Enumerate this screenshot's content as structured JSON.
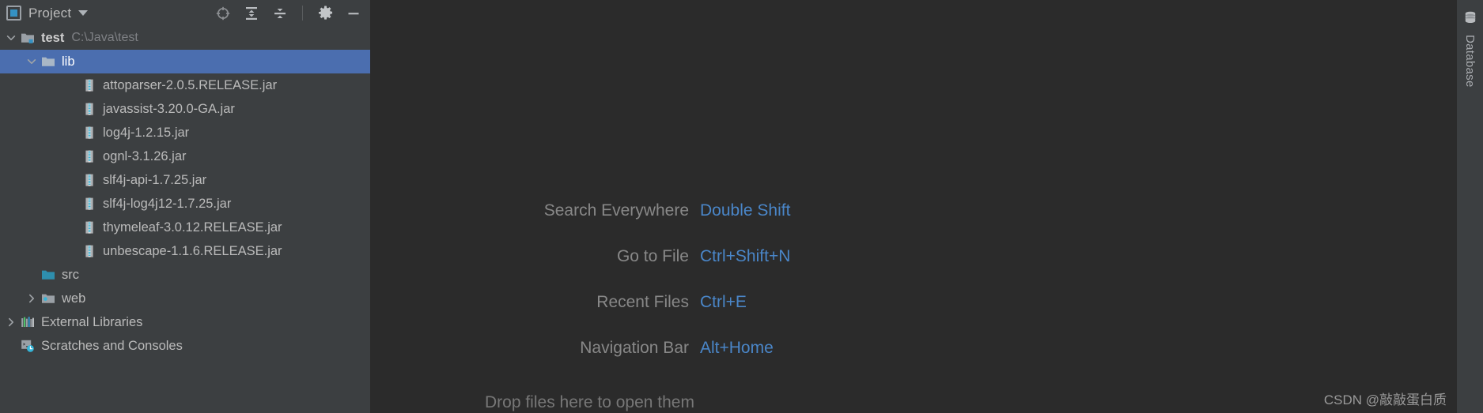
{
  "panel": {
    "title": "Project",
    "icons": {
      "window": "project-window-icon",
      "dropdown": "chevron-down-icon",
      "locate": "scroll-from-source-icon",
      "expand": "expand-all-icon",
      "collapse": "collapse-all-icon",
      "settings": "gear-icon",
      "hide": "minimize-icon"
    }
  },
  "tree": {
    "rows": [
      {
        "label": "test",
        "sub": "C:\\Java\\test",
        "indent": 0,
        "arrow": "expanded",
        "icon": "module-folder-icon",
        "bold": true,
        "selected": false
      },
      {
        "label": "lib",
        "sub": "",
        "indent": 1,
        "arrow": "expanded",
        "icon": "folder-icon",
        "bold": false,
        "selected": true
      },
      {
        "label": "attoparser-2.0.5.RELEASE.jar",
        "sub": "",
        "indent": 3,
        "arrow": "none",
        "icon": "jar-icon",
        "bold": false,
        "selected": false
      },
      {
        "label": "javassist-3.20.0-GA.jar",
        "sub": "",
        "indent": 3,
        "arrow": "none",
        "icon": "jar-icon",
        "bold": false,
        "selected": false
      },
      {
        "label": "log4j-1.2.15.jar",
        "sub": "",
        "indent": 3,
        "arrow": "none",
        "icon": "jar-icon",
        "bold": false,
        "selected": false
      },
      {
        "label": "ognl-3.1.26.jar",
        "sub": "",
        "indent": 3,
        "arrow": "none",
        "icon": "jar-icon",
        "bold": false,
        "selected": false
      },
      {
        "label": "slf4j-api-1.7.25.jar",
        "sub": "",
        "indent": 3,
        "arrow": "none",
        "icon": "jar-icon",
        "bold": false,
        "selected": false
      },
      {
        "label": "slf4j-log4j12-1.7.25.jar",
        "sub": "",
        "indent": 3,
        "arrow": "none",
        "icon": "jar-icon",
        "bold": false,
        "selected": false
      },
      {
        "label": "thymeleaf-3.0.12.RELEASE.jar",
        "sub": "",
        "indent": 3,
        "arrow": "none",
        "icon": "jar-icon",
        "bold": false,
        "selected": false
      },
      {
        "label": "unbescape-1.1.6.RELEASE.jar",
        "sub": "",
        "indent": 3,
        "arrow": "none",
        "icon": "jar-icon",
        "bold": false,
        "selected": false
      },
      {
        "label": "src",
        "sub": "",
        "indent": 1,
        "arrow": "none",
        "icon": "source-root-icon",
        "bold": false,
        "selected": false
      },
      {
        "label": "web",
        "sub": "",
        "indent": 1,
        "arrow": "collapsed",
        "icon": "web-root-icon",
        "bold": false,
        "selected": false
      },
      {
        "label": "External Libraries",
        "sub": "",
        "indent": 0,
        "arrow": "collapsed",
        "icon": "external-libraries-icon",
        "bold": false,
        "selected": false
      },
      {
        "label": "Scratches and Consoles",
        "sub": "",
        "indent": 0,
        "arrow": "none",
        "icon": "scratches-icon",
        "bold": false,
        "selected": false
      }
    ]
  },
  "editor": {
    "shortcuts": [
      {
        "label": "Search Everywhere",
        "key": "Double Shift"
      },
      {
        "label": "Go to File",
        "key": "Ctrl+Shift+N"
      },
      {
        "label": "Recent Files",
        "key": "Ctrl+E"
      },
      {
        "label": "Navigation Bar",
        "key": "Alt+Home"
      }
    ],
    "drop_hint": "Drop files here to open them"
  },
  "right_stripe": {
    "items": [
      {
        "label": "Database",
        "icon": "database-icon"
      }
    ]
  },
  "watermark": "CSDN @敲敲蛋白质",
  "colors": {
    "panel_bg": "#3c3f41",
    "editor_bg": "#2b2b2b",
    "selection": "#4b6eaf",
    "accent_blue": "#4a86c8",
    "text": "#bbbbbb",
    "muted": "#888888"
  }
}
